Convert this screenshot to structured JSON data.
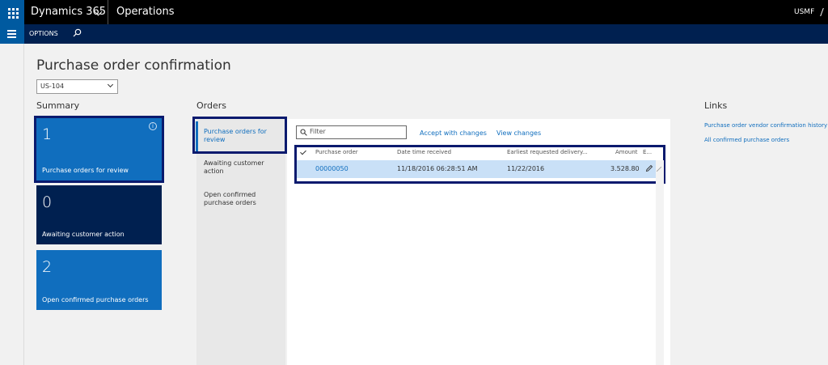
{
  "topbar": {
    "brand": "Dynamics 365",
    "module": "Operations",
    "company": "USMF"
  },
  "actionbar": {
    "options_label": "OPTIONS"
  },
  "page": {
    "title": "Purchase order confirmation",
    "company_select": "US-104"
  },
  "summary": {
    "label": "Summary",
    "tiles": [
      {
        "count": "1",
        "label": "Purchase orders for review"
      },
      {
        "count": "0",
        "label": "Awaiting customer action"
      },
      {
        "count": "2",
        "label": "Open confirmed purchase orders"
      }
    ]
  },
  "orders": {
    "label": "Orders",
    "nav": [
      {
        "label": "Purchase orders for review"
      },
      {
        "label": "Awaiting customer action"
      },
      {
        "label": "Open confirmed purchase orders"
      }
    ]
  },
  "grid": {
    "filter_placeholder": "Filter",
    "accept_label": "Accept with changes",
    "view_label": "View changes",
    "columns": [
      "Purchase order",
      "Date time received",
      "Earliest requested delivery...",
      "Amount",
      "E..."
    ],
    "rows": [
      {
        "po": "00000050",
        "received": "11/18/2016 06:28:51 AM",
        "delivery": "11/22/2016",
        "amount": "3.528.80"
      }
    ]
  },
  "links": {
    "label": "Links",
    "items": [
      "Purchase order vendor confirmation history",
      "All confirmed purchase orders"
    ]
  },
  "colors": {
    "accent": "#106ebe",
    "navy": "#002050",
    "highlight_border": "#0a1a6e"
  }
}
